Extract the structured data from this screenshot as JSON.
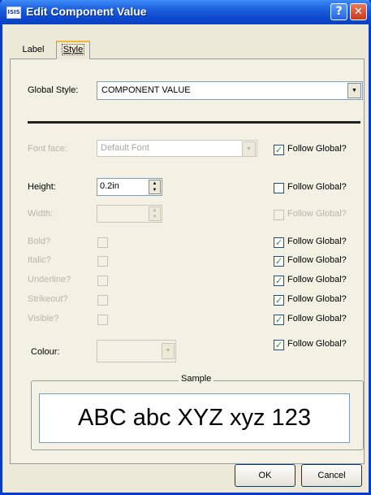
{
  "window": {
    "title": "Edit Component Value",
    "app_icon_text": "ISIS",
    "help_glyph": "?",
    "close_glyph": "✕"
  },
  "tabs": [
    {
      "label": "Label",
      "active": false
    },
    {
      "label": "Style",
      "active": true
    }
  ],
  "global_style": {
    "label": "Global Style:",
    "value": "COMPONENT VALUE",
    "arrow": "▼"
  },
  "properties": {
    "font_face": {
      "label": "Font face:",
      "value": "Default Font",
      "enabled": false,
      "follow_label": "Follow Global?",
      "follow_checked": true,
      "follow_enabled": true
    },
    "height": {
      "label": "Height:",
      "value": "0.2in",
      "enabled": true,
      "follow_label": "Follow Global?",
      "follow_checked": false,
      "follow_enabled": true
    },
    "width": {
      "label": "Width:",
      "value": "",
      "enabled": false,
      "follow_label": "Follow Global?",
      "follow_checked": false,
      "follow_enabled": false
    },
    "bold": {
      "label": "Bold?",
      "checked": false,
      "enabled": false,
      "follow_label": "Follow Global?",
      "follow_checked": true
    },
    "italic": {
      "label": "Italic?",
      "checked": false,
      "enabled": false,
      "follow_label": "Follow Global?",
      "follow_checked": true
    },
    "underline": {
      "label": "Underline?",
      "checked": false,
      "enabled": false,
      "follow_label": "Follow Global?",
      "follow_checked": true
    },
    "strikeout": {
      "label": "Strikeout?",
      "checked": false,
      "enabled": false,
      "follow_label": "Follow Global?",
      "follow_checked": true
    },
    "visible": {
      "label": "Visible?",
      "checked": false,
      "enabled": false,
      "follow_label": "Follow Global?",
      "follow_checked": true
    },
    "colour": {
      "label": "Colour:",
      "enabled": false,
      "follow_label": "Follow Global?",
      "follow_checked": true
    }
  },
  "check_glyph": "✓",
  "spin_glyph_up": "▲",
  "spin_glyph_down": "▼",
  "sample": {
    "caption": "Sample",
    "text": "ABC abc XYZ xyz 123"
  },
  "buttons": {
    "ok": "OK",
    "cancel": "Cancel"
  },
  "colors": {
    "titlebar": "#0b48cf",
    "check": "#21a121",
    "disabled_text": "#b8b6aa"
  }
}
